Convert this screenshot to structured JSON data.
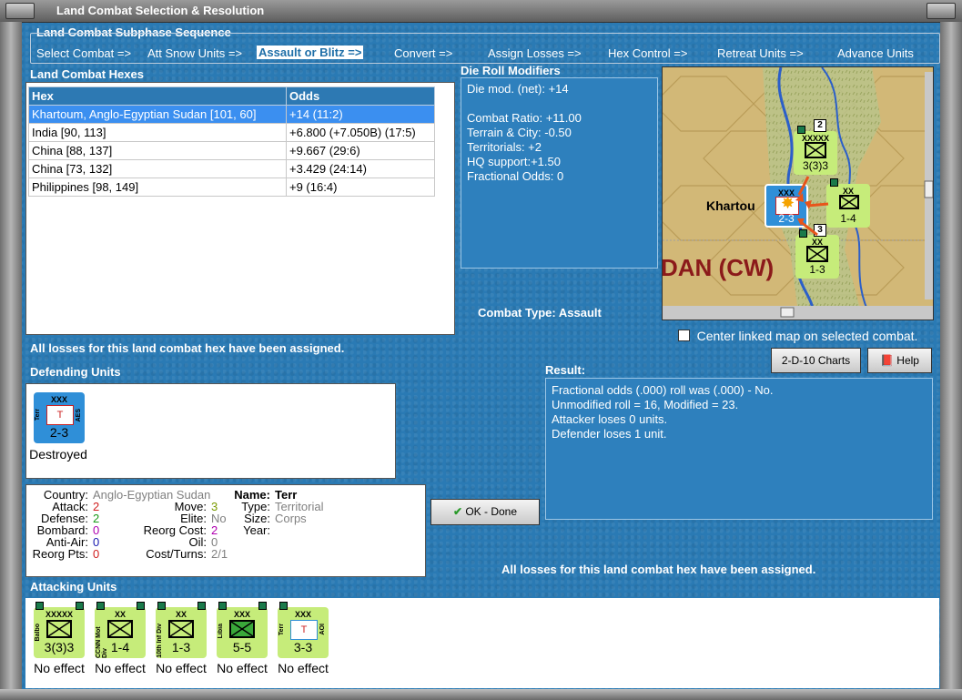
{
  "window": {
    "title": "Land Combat Selection & Resolution"
  },
  "subphase": {
    "heading": "Land Combat Subphase Sequence",
    "steps": [
      "Select Combat =>",
      "Att Snow Units =>",
      "Assault or Blitz =>",
      "Convert =>",
      "Assign Losses =>",
      "Hex Control =>",
      "Retreat Units =>",
      "Advance Units"
    ]
  },
  "hexes": {
    "heading": "Land Combat Hexes",
    "columns": [
      "Hex",
      "Odds"
    ],
    "rows": [
      {
        "hex": "Khartoum, Anglo-Egyptian Sudan [101, 60]",
        "odds": "+14 (11:2)"
      },
      {
        "hex": "India [90, 113]",
        "odds": "+6.800 (+7.050B) (17:5)"
      },
      {
        "hex": "China [88, 137]",
        "odds": "+9.667 (29:6)"
      },
      {
        "hex": "China [73, 132]",
        "odds": "+3.429 (24:14)"
      },
      {
        "hex": "Philippines [98, 149]",
        "odds": "+9 (16:4)"
      }
    ]
  },
  "modifiers": {
    "heading": "Die Roll Modifiers",
    "lines": [
      "Die mod. (net): +14",
      "",
      "Combat Ratio: +11.00",
      "Terrain & City: -0.50",
      "Territorials: +2",
      "HQ support:+1.50",
      "Fractional Odds: 0"
    ]
  },
  "map": {
    "city_label": "Khartou",
    "region_label": "DAN (CW)",
    "center_checkbox_label": "Center linked map on selected combat.",
    "counters": [
      {
        "size": "XXXXX",
        "strength": "3(3)3",
        "stack": "2"
      },
      {
        "size": "XX",
        "strength": "1-4"
      },
      {
        "size": "XX",
        "strength": "1-3",
        "stack": "3"
      },
      {
        "size": "XXX",
        "strength": "2-3"
      }
    ]
  },
  "combat_type": {
    "label": "Combat Type:",
    "value": "Assault"
  },
  "losses_msg_top": "All losses for this land combat hex have been assigned.",
  "losses_msg_bottom": "All losses for this land combat hex have been assigned.",
  "buttons": {
    "charts": "2-D-10 Charts",
    "help": "Help",
    "ok": "OK - Done"
  },
  "defending": {
    "heading": "Defending Units",
    "units": [
      {
        "size": "XXX",
        "strength": "2-3",
        "side_left": "Terr",
        "side_right": "AES",
        "status": "Destroyed",
        "color": "#2f8fd8"
      }
    ]
  },
  "result": {
    "heading": "Result:",
    "lines": [
      "Fractional odds (.000) roll was (.000)  - No.",
      "Unmodified roll = 16, Modified = 23.",
      "Attacker loses 0 units.",
      "Defender loses 1 unit."
    ]
  },
  "unit_info": {
    "country_label": "Country:",
    "country": "Anglo-Egyptian Sudan",
    "attack_label": "Attack:",
    "attack": "2",
    "defense_label": "Defense:",
    "defense": "2",
    "bombard_label": "Bombard:",
    "bombard": "0",
    "antiair_label": "Anti-Air:",
    "antiair": "0",
    "reorgpts_label": "Reorg Pts:",
    "reorgpts": "0",
    "move_label": "Move:",
    "move": "3",
    "elite_label": "Elite:",
    "elite": "No",
    "reorgcost_label": "Reorg Cost:",
    "reorgcost": "2",
    "oil_label": "Oil:",
    "oil": "0",
    "costturns_label": "Cost/Turns:",
    "costturns": "2/1",
    "name_label": "Name:",
    "name": "Terr",
    "type_label": "Type:",
    "type": "Territorial",
    "size_label": "Size:",
    "size": "Corps",
    "year_label": "Year:",
    "year": ""
  },
  "attacking": {
    "heading": "Attacking Units",
    "units": [
      {
        "size": "XXXXX",
        "strength": "3(3)3",
        "side_left": "Balbo",
        "side_right": "",
        "status": "No effect"
      },
      {
        "size": "XX",
        "strength": "1-4",
        "side_left": "CCNN Mot Div",
        "side_right": "",
        "status": "No effect"
      },
      {
        "size": "XX",
        "strength": "1-3",
        "side_left": "10th Inf Div",
        "side_right": "",
        "status": "No effect"
      },
      {
        "size": "XXX",
        "strength": "5-5",
        "side_left": "Libia",
        "side_right": "",
        "status": "No effect"
      },
      {
        "size": "XXX",
        "strength": "3-3",
        "side_left": "Terr",
        "side_right": "AOI",
        "status": "No effect"
      }
    ]
  },
  "colors": {
    "attacker_counter": "#c6ec7a",
    "defender_counter": "#2f8fd8",
    "selected_row": "#3b8ff0"
  }
}
